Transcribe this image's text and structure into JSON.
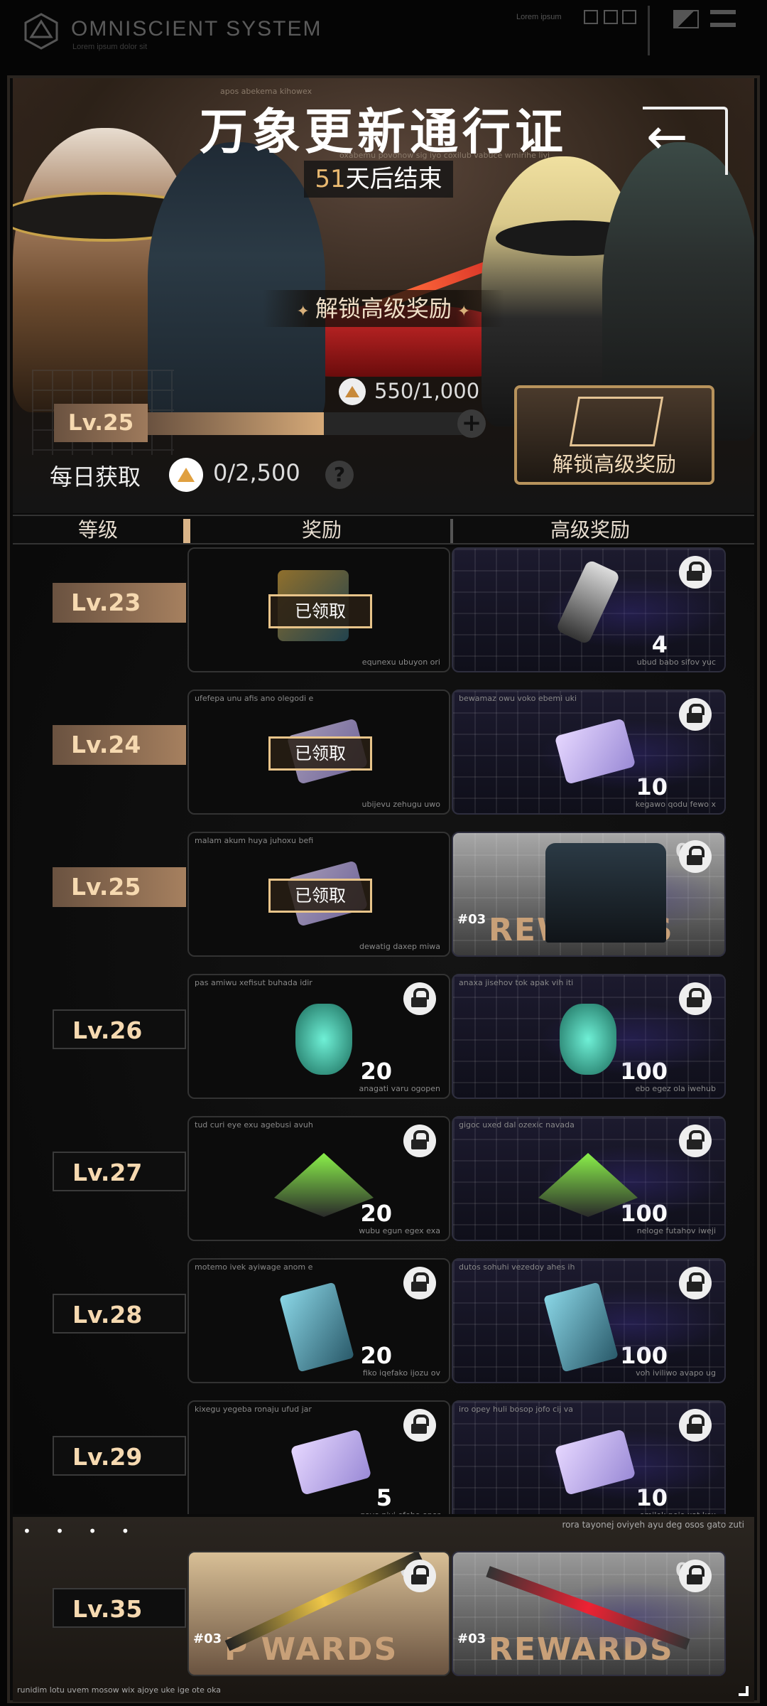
{
  "system": {
    "title": "OMNISCIENT  SYSTEM",
    "subtitle": "Lorem ipsum dolor sit",
    "tiny": "Lorem ipsum"
  },
  "header": {
    "small_caption": "apos abekema kihowex",
    "title": "万象更新通行证",
    "small_caption2": "oxabemu povohow sig iyo coxilub vabuce wmirihe livi",
    "countdown_num": "51",
    "countdown_text": "天后结束",
    "unlock_banner": "解锁高级奖励"
  },
  "progress": {
    "xp_current": "550",
    "xp_max": "1,000",
    "xp_fraction": 0.55,
    "level": "Lv.25",
    "daily_label": "每日获取",
    "daily_current": "0",
    "daily_max": "2,500",
    "help": "?"
  },
  "unlock_button": {
    "label": "解锁高级奖励"
  },
  "tabs": {
    "level": "等级",
    "rewards": "奖励",
    "premium": "高级奖励"
  },
  "claimed_label": "已领取",
  "rows": [
    {
      "level": "Lv.23",
      "state": "claimed",
      "free": {
        "caption": "",
        "footer": "equnexu ubuyon ori",
        "qty": "",
        "item": "chest-icon",
        "claimed": true
      },
      "prem": {
        "caption": "",
        "footer": "ubud babo sifov yuc",
        "qty": "4",
        "item": "gun-icon",
        "locked": true,
        "style": "grid"
      }
    },
    {
      "level": "Lv.24",
      "state": "claimed",
      "free": {
        "caption": "ufefepa unu afis ano olegodi e",
        "footer": "ubijevu zehugu uwo",
        "qty": "",
        "item": "ticket-icon",
        "claimed": true
      },
      "prem": {
        "caption": "bewamaz owu voko ebemi uki",
        "footer": "kegawo qodu fewo x",
        "qty": "10",
        "item": "ticket-icon",
        "locked": true,
        "style": "grid"
      }
    },
    {
      "level": "Lv.25",
      "state": "claimed",
      "free": {
        "caption": "malam akum huya juhoxu befi",
        "footer": "dewatig daxep miwa",
        "qty": "",
        "item": "chip-icon",
        "claimed": true
      },
      "prem": {
        "caption": "",
        "footer": "",
        "qty": "",
        "item": "outfit-icon",
        "locked": true,
        "style": "gold",
        "num": "01",
        "rewards": "REWARDS",
        "tag": "#03"
      }
    },
    {
      "level": "Lv.26",
      "state": "open",
      "free": {
        "caption": "pas amiwu xefisut buhada idir",
        "footer": "anagati varu ogopen",
        "qty": "20",
        "item": "mask-icon",
        "locked": true
      },
      "prem": {
        "caption": "anaxa jisehov tok apak vih iti",
        "footer": "ebo egez ola iwehub",
        "qty": "100",
        "item": "mask-icon",
        "locked": true,
        "style": "grid"
      }
    },
    {
      "level": "Lv.27",
      "state": "open",
      "free": {
        "caption": "tud curi eye exu agebusi avuh",
        "footer": "wubu egun egex exa",
        "qty": "20",
        "item": "pyramid-icon",
        "locked": true
      },
      "prem": {
        "caption": "gigoc uxed dal ozexic navada",
        "footer": "neloge futahov iweji",
        "qty": "100",
        "item": "pyramid-icon",
        "locked": true,
        "style": "grid"
      }
    },
    {
      "level": "Lv.28",
      "state": "open",
      "free": {
        "caption": "motemo ivek ayiwage anom e",
        "footer": "fiko iqefako ijozu ov",
        "qty": "20",
        "item": "book-icon",
        "locked": true
      },
      "prem": {
        "caption": "dutos sohuhi vezedoy ahes ih",
        "footer": "voh iviliwo avapo ug",
        "qty": "100",
        "item": "book-icon",
        "locked": true,
        "style": "grid"
      }
    },
    {
      "level": "Lv.29",
      "state": "open",
      "free": {
        "caption": "kixegu yegeba ronaju ufud jar",
        "footer": "qoye piyi ofebo opor",
        "qty": "5",
        "item": "ticket-icon",
        "locked": true
      },
      "prem": {
        "caption": "iro opey huli bosop jofo cij va",
        "footer": "omilek pojo xat kex",
        "qty": "10",
        "item": "ticket-icon",
        "locked": true,
        "style": "grid"
      }
    }
  ],
  "milestone": {
    "caption": "rora tayonej oviyeh ayu deg osos gato zuti",
    "dots": "• • • •",
    "level": "Lv.35",
    "footer": "runidim lotu uvem mosow wix ajoye uke ige ote oka",
    "num": "01",
    "rewards_free": "P WARDS",
    "rewards_prem": "REWARDS",
    "tag": "#03"
  }
}
